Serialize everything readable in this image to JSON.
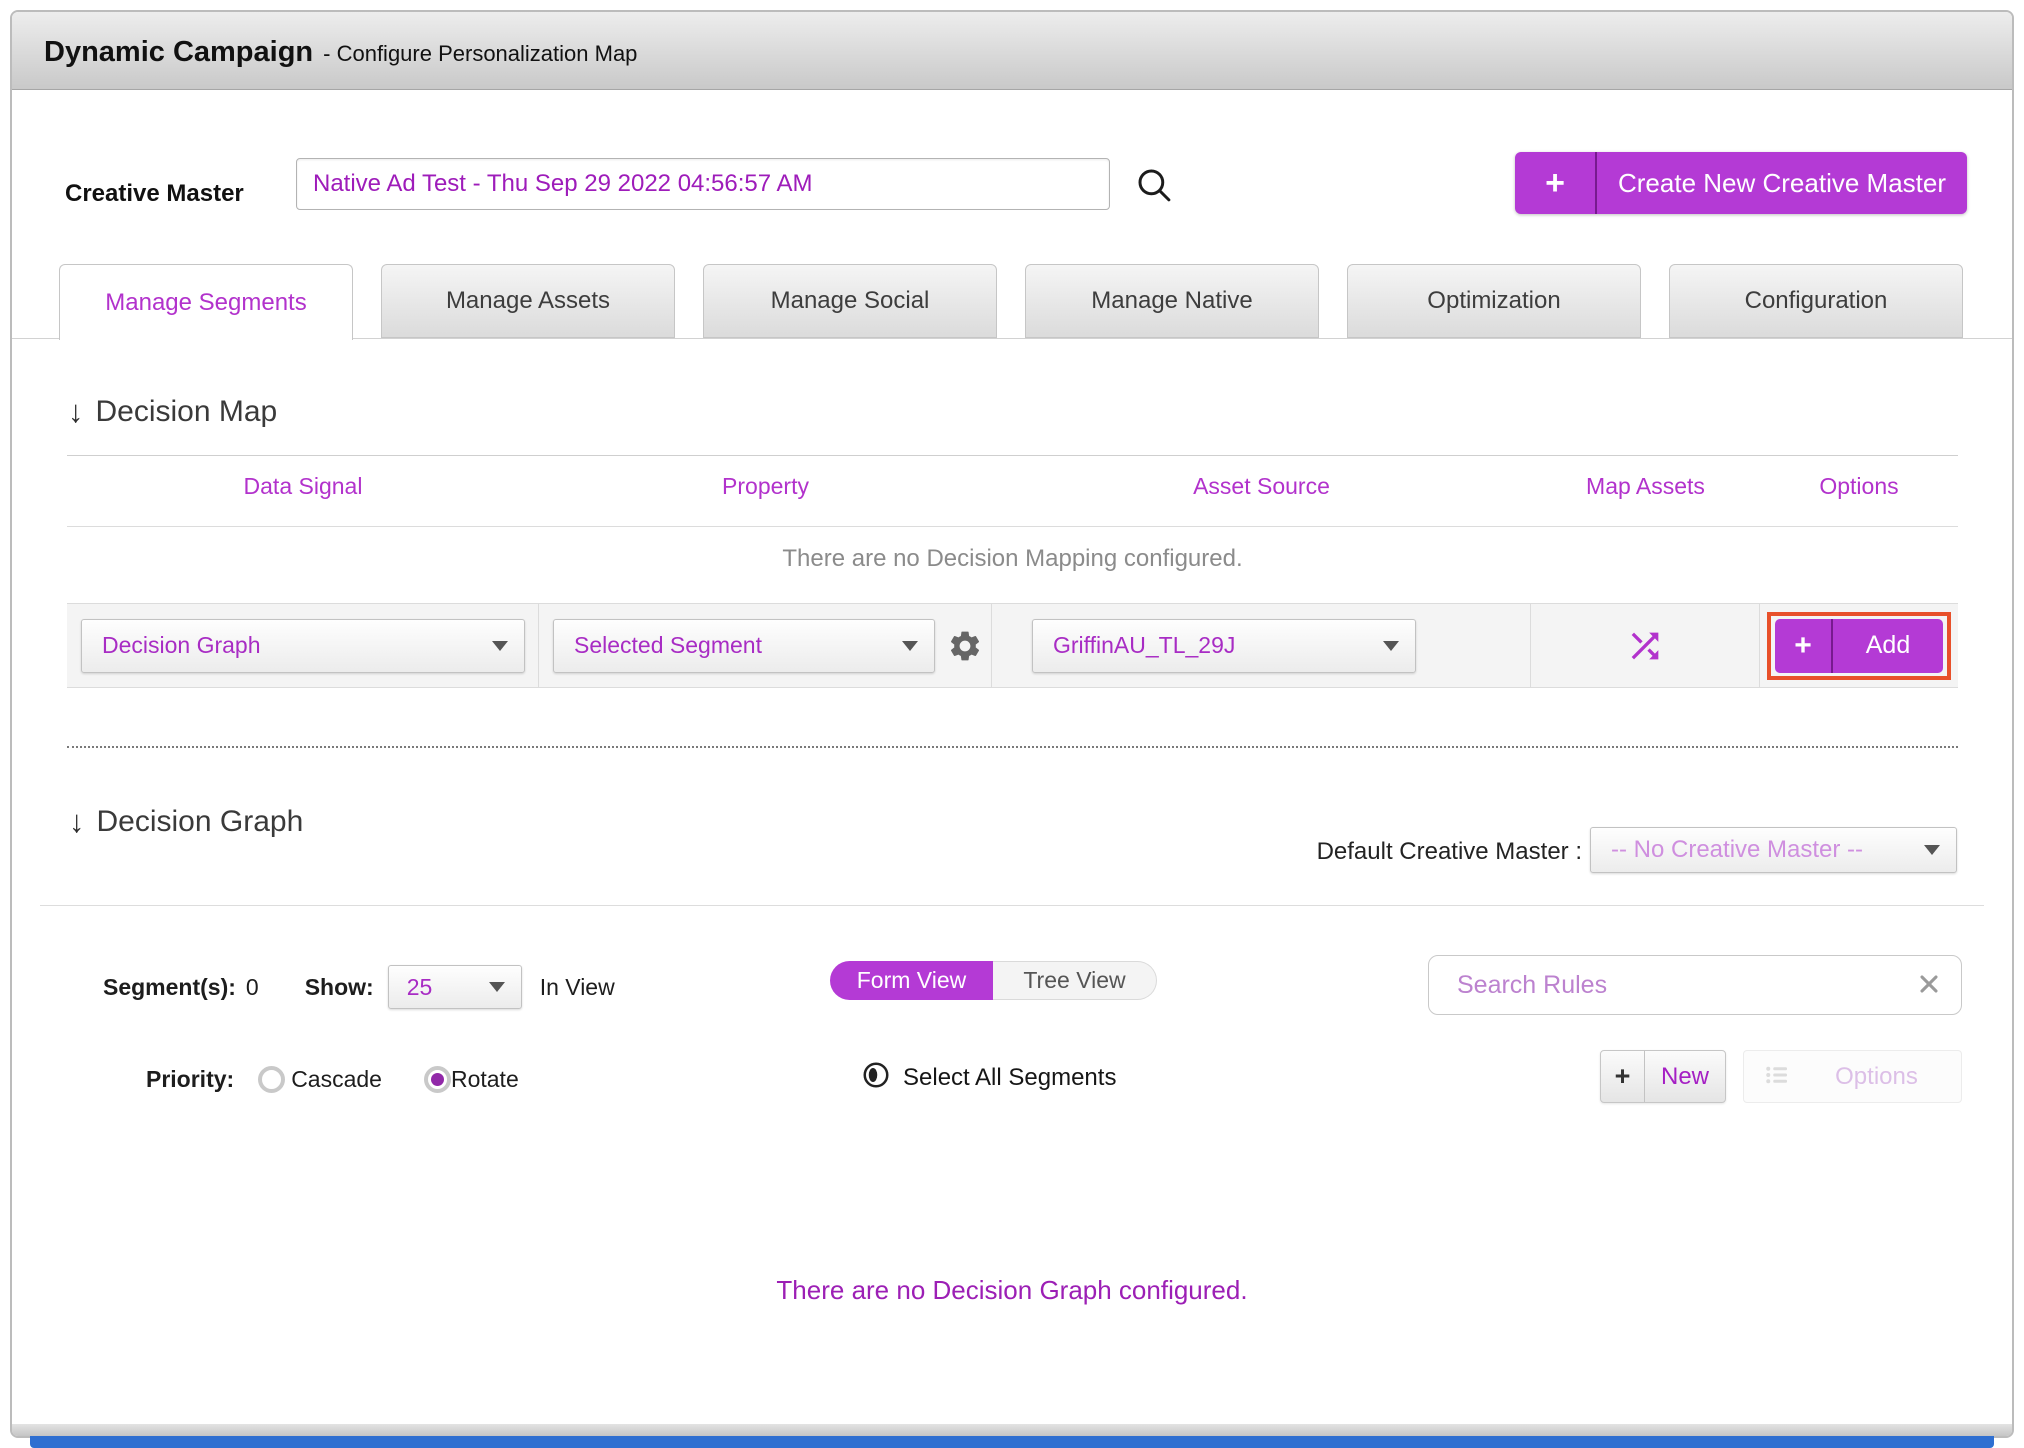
{
  "icons": {
    "down_arrow": "↓",
    "plus": "+"
  },
  "header": {
    "title": "Dynamic Campaign",
    "subtitle": "- Configure Personalization Map"
  },
  "creative_master": {
    "label": "Creative Master",
    "value": "Native Ad Test - Thu Sep 29 2022 04:56:57 AM",
    "create_button_label": "Create New Creative Master"
  },
  "tabs": [
    {
      "label": "Manage Segments",
      "active": true
    },
    {
      "label": "Manage Assets",
      "active": false
    },
    {
      "label": "Manage Social",
      "active": false
    },
    {
      "label": "Manage Native",
      "active": false
    },
    {
      "label": "Optimization",
      "active": false
    },
    {
      "label": "Configuration",
      "active": false
    }
  ],
  "decision_map": {
    "heading": "Decision Map",
    "columns": [
      "Data Signal",
      "Property",
      "Asset Source",
      "Map Assets",
      "Options"
    ],
    "empty_message": "There are no Decision Mapping configured.",
    "row": {
      "data_signal_value": "Decision Graph",
      "property_value": "Selected Segment",
      "asset_source_value": "GriffinAU_TL_29J",
      "add_button_label": "Add"
    }
  },
  "decision_graph": {
    "heading": "Decision Graph",
    "default_creative_master_label": "Default Creative Master :",
    "default_creative_master_value": "-- No Creative Master --",
    "segments_label": "Segment(s):",
    "segments_count": "0",
    "show_label": "Show:",
    "show_value": "25",
    "in_view_label": "In View",
    "view_toggle": {
      "form": "Form View",
      "tree": "Tree View"
    },
    "search_placeholder": "Search Rules",
    "priority": {
      "label": "Priority:",
      "options": [
        {
          "label": "Cascade",
          "selected": false
        },
        {
          "label": "Rotate",
          "selected": true
        }
      ]
    },
    "select_all_label": "Select All Segments",
    "new_button_label": "New",
    "options_button_label": "Options",
    "empty_message": "There are no Decision Graph configured."
  },
  "colors": {
    "accent_purple": "#b43ad5",
    "text_purple": "#b232cc",
    "highlight_orange": "#e8502a",
    "footer_blue": "#2f6fd1"
  }
}
